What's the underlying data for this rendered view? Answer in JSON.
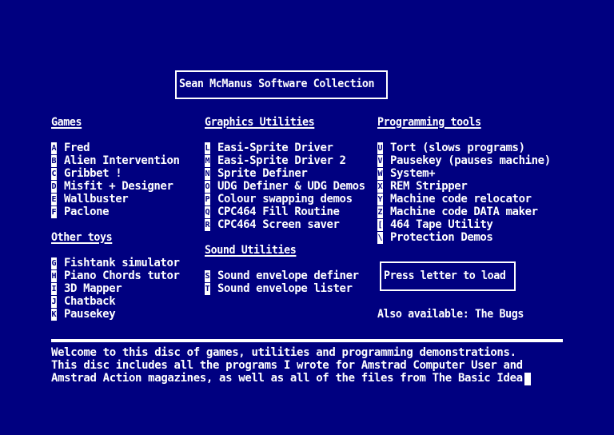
{
  "title": "Sean McManus Software Collection",
  "columns": [
    {
      "sections": [
        {
          "heading": "Games",
          "items": [
            {
              "key": "A",
              "label": "Fred"
            },
            {
              "key": "B",
              "label": "Alien Intervention"
            },
            {
              "key": "C",
              "label": "Gribbet !"
            },
            {
              "key": "D",
              "label": "Misfit + Designer"
            },
            {
              "key": "E",
              "label": "Wallbuster"
            },
            {
              "key": "F",
              "label": "Paclone"
            }
          ]
        },
        {
          "heading": "Other toys",
          "items": [
            {
              "key": "G",
              "label": "Fishtank simulator"
            },
            {
              "key": "H",
              "label": "Piano Chords tutor"
            },
            {
              "key": "I",
              "label": "3D Mapper"
            },
            {
              "key": "J",
              "label": "Chatback"
            },
            {
              "key": "K",
              "label": "Pausekey"
            }
          ]
        }
      ]
    },
    {
      "sections": [
        {
          "heading": "Graphics Utilities",
          "items": [
            {
              "key": "L",
              "label": "Easi-Sprite Driver"
            },
            {
              "key": "M",
              "label": "Easi-Sprite Driver 2"
            },
            {
              "key": "N",
              "label": "Sprite Definer"
            },
            {
              "key": "O",
              "label": "UDG Definer & UDG Demos"
            },
            {
              "key": "P",
              "label": "Colour swapping demos"
            },
            {
              "key": "Q",
              "label": "CPC464 Fill Routine"
            },
            {
              "key": "R",
              "label": "CPC464 Screen saver"
            }
          ]
        },
        {
          "heading": "Sound Utilities",
          "items": [
            {
              "key": "S",
              "label": "Sound envelope definer"
            },
            {
              "key": "T",
              "label": "Sound envelope lister"
            }
          ]
        }
      ]
    },
    {
      "sections": [
        {
          "heading": "Programming tools",
          "items": [
            {
              "key": "U",
              "label": "Tort (slows programs)"
            },
            {
              "key": "V",
              "label": "Pausekey (pauses machine)"
            },
            {
              "key": "W",
              "label": "System+"
            },
            {
              "key": "X",
              "label": "REM Stripper"
            },
            {
              "key": "Y",
              "label": "Machine code relocator"
            },
            {
              "key": "Z",
              "label": "Machine code DATA maker"
            },
            {
              "key": "[",
              "label": "464 Tape Utility"
            },
            {
              "key": "\\",
              "label": "Protection Demos"
            }
          ]
        }
      ]
    }
  ],
  "prompt": "Press letter to load",
  "also_available": "Also available: The Bugs",
  "footer": {
    "lines": [
      "Welcome to this disc of games, utilities and programming demonstrations.",
      "This disc includes all the programs I wrote for Amstrad Computer User and",
      "Amstrad Action magazines, as well as all of the files from The Basic Idea."
    ]
  },
  "colors": {
    "background": "#000080",
    "foreground": "#ffffff"
  }
}
